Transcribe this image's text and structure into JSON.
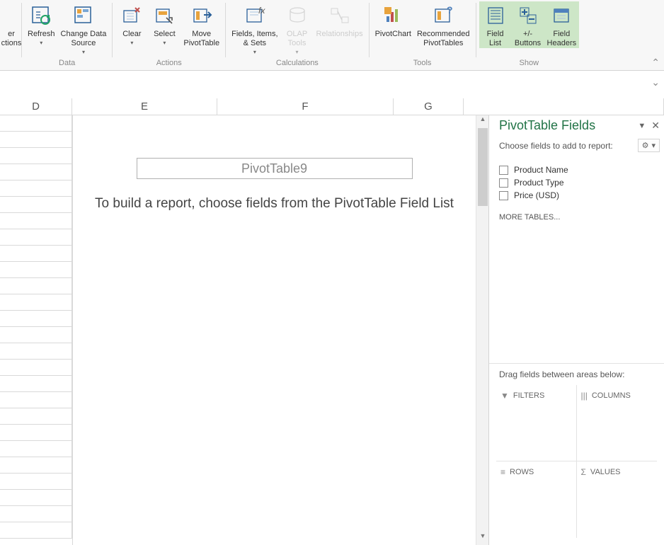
{
  "ribbon": {
    "partial_group_lines": [
      "er",
      "ctions"
    ],
    "data_group": {
      "refresh": "Refresh",
      "change_data": "Change Data\nSource",
      "label": "Data"
    },
    "actions_group": {
      "clear": "Clear",
      "select": "Select",
      "move": "Move\nPivotTable",
      "label": "Actions"
    },
    "calc_group": {
      "fields": "Fields, Items,\n& Sets",
      "olap": "OLAP\nTools",
      "rel": "Relationships",
      "label": "Calculations"
    },
    "tools_group": {
      "pivotchart": "PivotChart",
      "recommended": "Recommended\nPivotTables",
      "label": "Tools"
    },
    "show_group": {
      "fieldlist": "Field\nList",
      "buttons": "+/-\nButtons",
      "headers": "Field\nHeaders",
      "label": "Show"
    }
  },
  "columns": {
    "d": "D",
    "e": "E",
    "f": "F",
    "g": "G"
  },
  "pivot": {
    "title": "PivotTable9",
    "message": "To build a report, choose fields from the PivotTable Field List"
  },
  "pane": {
    "title": "PivotTable Fields",
    "subtitle": "Choose fields to add to report:",
    "fields": {
      "f1": "Product Name",
      "f2": "Product Type",
      "f3": "Price (USD)"
    },
    "more_tables": "MORE TABLES...",
    "drag_hint": "Drag fields between areas below:",
    "areas": {
      "filters": "FILTERS",
      "columns": "COLUMNS",
      "rows": "ROWS",
      "values": "VALUES"
    }
  }
}
